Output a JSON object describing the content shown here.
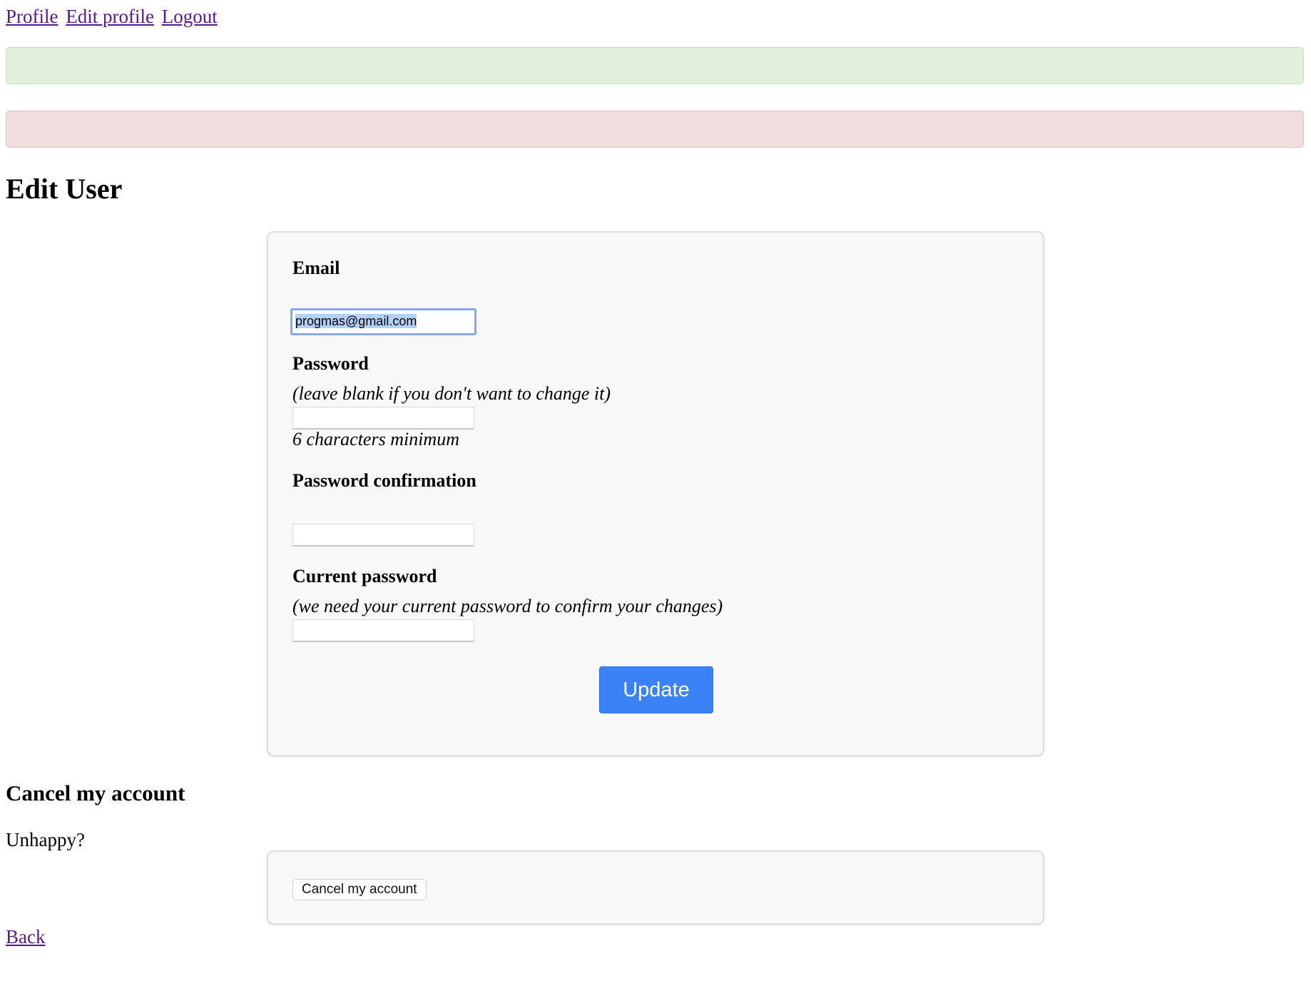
{
  "nav": {
    "profile": "Profile",
    "edit_profile": "Edit profile",
    "logout": "Logout"
  },
  "alerts": {
    "notice_text": "",
    "error_text": "",
    "notice_color": "#e3efdc",
    "error_color": "#f0dede"
  },
  "page": {
    "title": "Edit User"
  },
  "form": {
    "email_label": "Email",
    "email_value": "progmas@gmail.com",
    "password_label": "Password",
    "password_hint": "(leave blank if you don't want to change it)",
    "password_min_hint": "6 characters minimum",
    "password_confirmation_label": "Password confirmation",
    "current_password_label": "Current password",
    "current_password_hint": "(we need your current password to confirm your changes)",
    "update_label": "Update",
    "update_color": "#3b82f6"
  },
  "cancel_section": {
    "title": "Cancel my account",
    "text": "Unhappy?",
    "button_label": "Cancel my account"
  },
  "footer": {
    "back_label": "Back"
  }
}
